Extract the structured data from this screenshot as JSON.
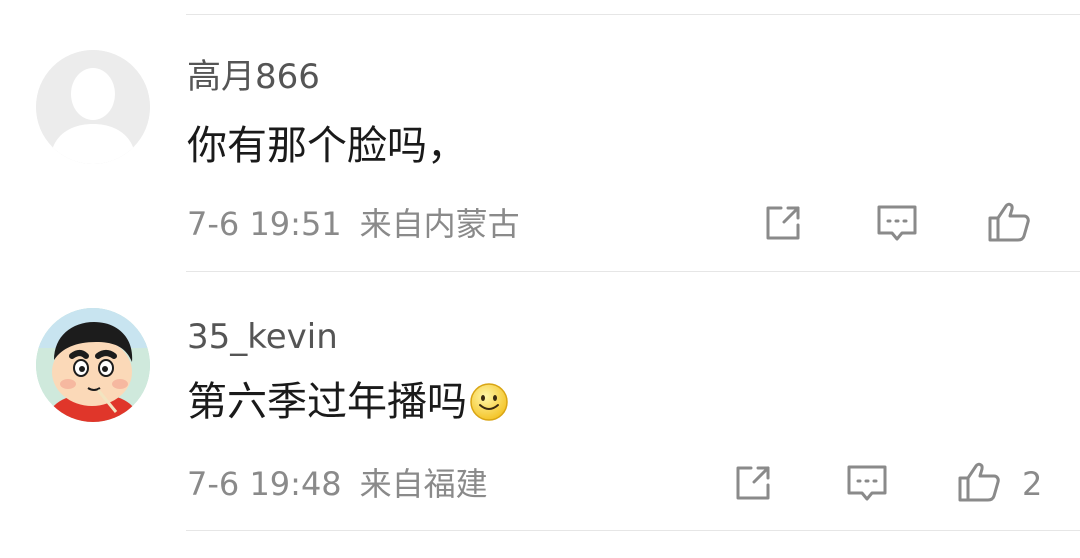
{
  "comments": [
    {
      "username": "高月866",
      "text": "你有那个脸吗，",
      "time": "7-6 19:51",
      "location": "来自内蒙古",
      "avatar": "default-avatar-icon",
      "like_count": ""
    },
    {
      "username": "35_kevin",
      "text": "第六季过年播吗",
      "emoji": "smile-emoji-icon",
      "time": "7-6 19:48",
      "location": "来自福建",
      "avatar": "cartoon-boy-avatar",
      "like_count": "2"
    }
  ],
  "colors": {
    "username": "#555555",
    "meta": "#8a8a8a",
    "divider": "#e6e6e6",
    "icon": "#8a8a8a"
  }
}
